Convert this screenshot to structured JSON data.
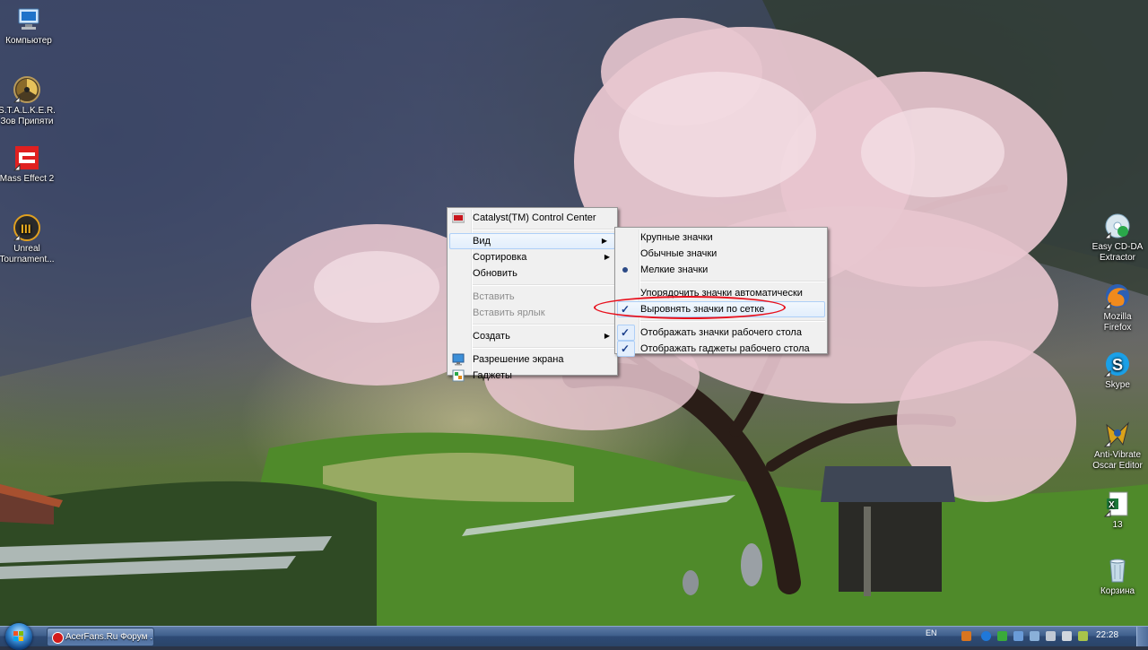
{
  "desktop_left_icons": [
    {
      "label": "Компьютер",
      "icon": "computer-icon"
    },
    {
      "label": "S.T.A.L.K.E.R. Зов Припяти",
      "icon": "stalker-game-icon"
    },
    {
      "label": "Mass Effect 2",
      "icon": "mass-effect-icon"
    },
    {
      "label": "Unreal Tournament...",
      "icon": "unreal-tournament-icon"
    }
  ],
  "desktop_right_icons": [
    {
      "label": "Easy CD-DA Extractor",
      "icon": "cd-extractor-icon"
    },
    {
      "label": "Mozilla Firefox",
      "icon": "firefox-icon"
    },
    {
      "label": "Skype",
      "icon": "skype-icon"
    },
    {
      "label": "Anti-Vibrate Oscar Editor",
      "icon": "oscar-editor-icon"
    },
    {
      "label": "13",
      "icon": "excel-file-icon"
    },
    {
      "label": "Корзина",
      "icon": "recycle-bin-icon"
    }
  ],
  "context_menu": {
    "catalyst": "Catalyst(TM) Control Center",
    "view": "Вид",
    "sort": "Сортировка",
    "refresh": "Обновить",
    "paste": "Вставить",
    "paste_shortcut": "Вставить ярлык",
    "create": "Создать",
    "screen_resolution": "Разрешение экрана",
    "gadgets": "Гаджеты"
  },
  "view_submenu": {
    "large_icons": "Крупные значки",
    "medium_icons": "Обычные значки",
    "small_icons": "Мелкие значки",
    "auto_arrange": "Упорядочить значки автоматически",
    "align_to_grid": "Выровнять значки по сетке",
    "show_desktop_icons": "Отображать значки рабочего стола",
    "show_gadgets": "Отображать гаджеты  рабочего стола",
    "selected_size": "Мелкие значки",
    "checked": [
      "Выровнять значки по сетке",
      "Отображать значки рабочего стола",
      "Отображать гаджеты  рабочего стола"
    ]
  },
  "taskbar": {
    "task_button": "AcerFans.Ru Форум ...",
    "language": "EN",
    "clock": "22:28"
  },
  "colors": {
    "highlight_ellipse": "#e8101c",
    "menu_bg": "#f0f0f0",
    "taskbar": "#3f5f8c"
  }
}
